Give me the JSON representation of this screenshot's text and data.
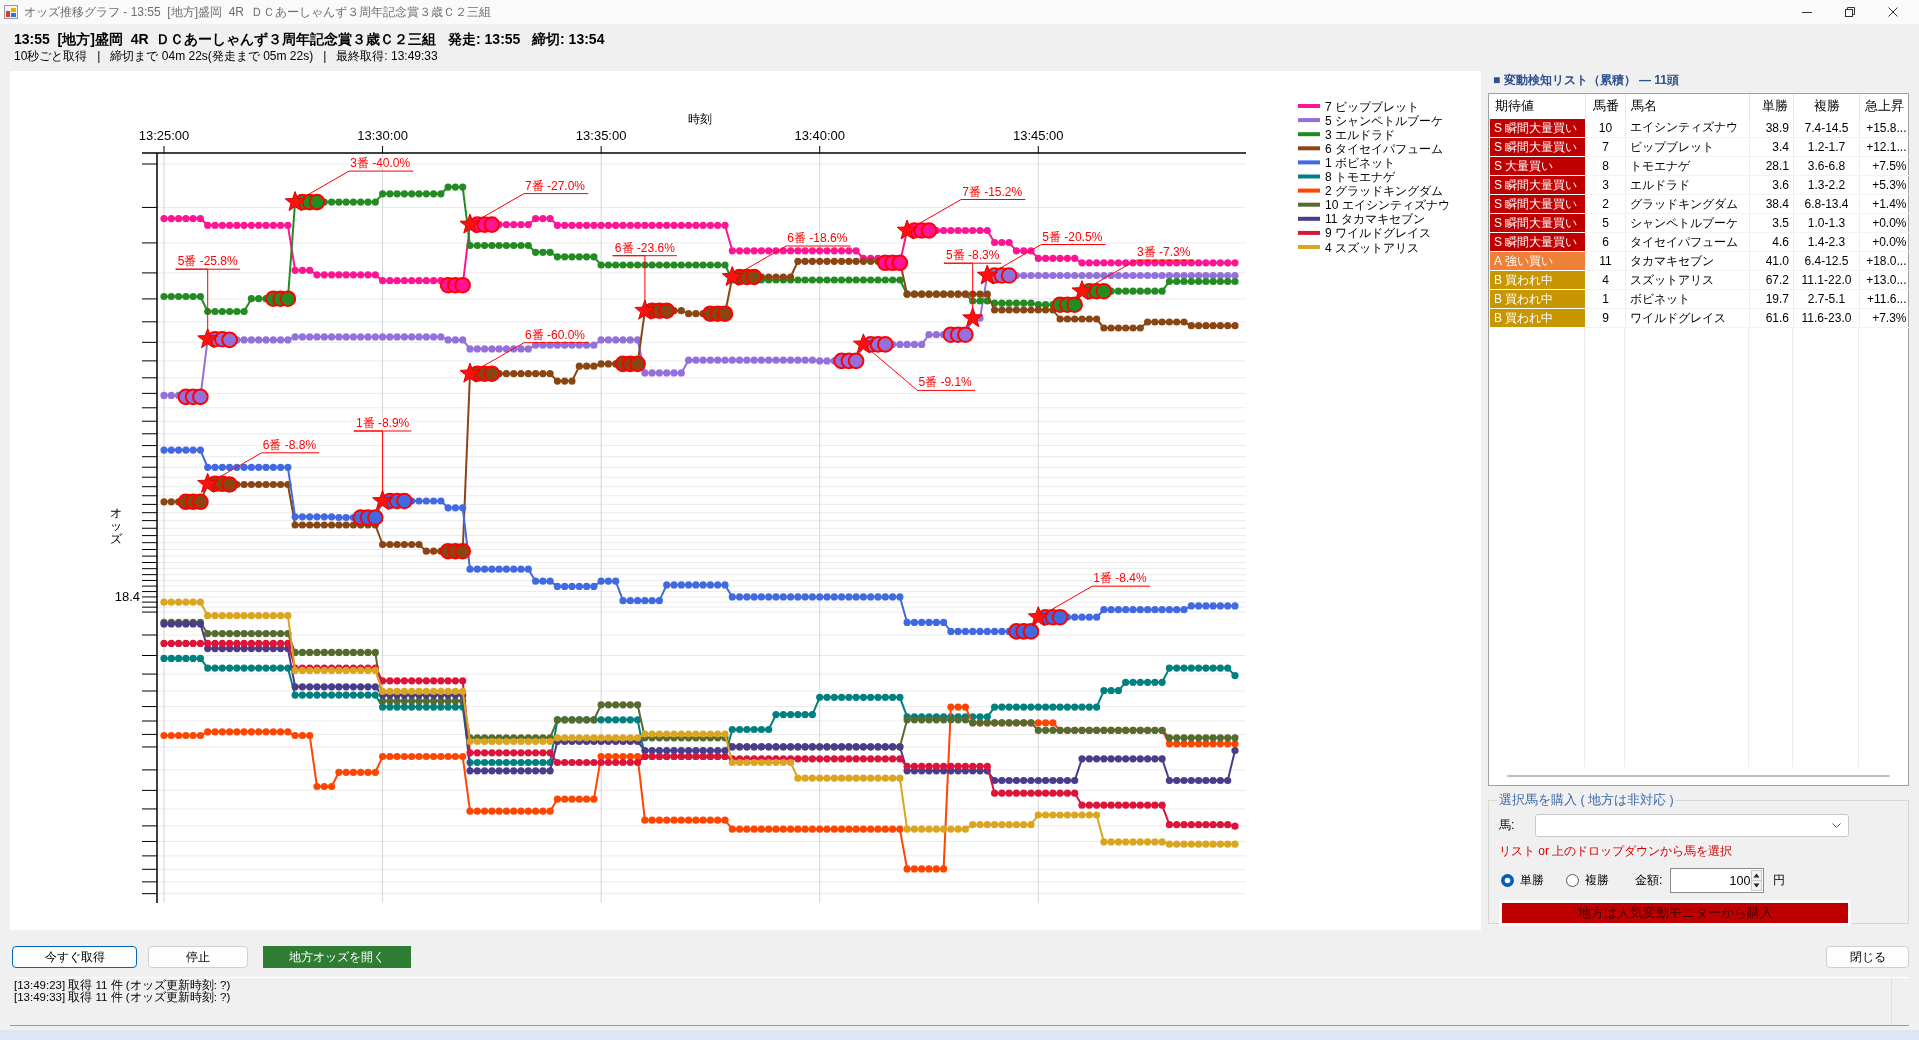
{
  "window": {
    "title": "オッズ推移グラフ - 13:55  [地方]盛岡  4R  ＤＣあーしゃんず３周年記念賞３歳Ｃ２三組"
  },
  "race_header": {
    "title": "13:55  [地方]盛岡  4R  ＤＣあーしゃんず３周年記念賞３歳Ｃ２三組   発走: 13:55   締切: 13:54",
    "status": "10秒ごと取得   |   締切まで 04m 22s(発走まで 05m 22s)   |   最終取得: 13:49:33"
  },
  "chart": {
    "x_axis_title": "時刻",
    "y_axis_title": "オッズ",
    "time_labels": [
      "13:25:00",
      "13:30:00",
      "13:35:00",
      "13:40:00",
      "13:45:00"
    ],
    "odds_label": "18.4",
    "legend": [
      {
        "name": "7 ビップブレット",
        "color": "#ff1493"
      },
      {
        "name": "5 シャンペトルブーケ",
        "color": "#9370db"
      },
      {
        "name": "3 エルドラド",
        "color": "#228b22"
      },
      {
        "name": "6 タイセイパフューム",
        "color": "#8b4513"
      },
      {
        "name": "1 ボビネット",
        "color": "#4169e1"
      },
      {
        "name": "8 トモエナゲ",
        "color": "#008080"
      },
      {
        "name": "2 グラッドキングダム",
        "color": "#ff4500"
      },
      {
        "name": "10 エイシンティズナウ",
        "color": "#556b2f"
      },
      {
        "name": "11 タカマキセブン",
        "color": "#483d8b"
      },
      {
        "name": "9 ワイルドグレイス",
        "color": "#dc143c"
      },
      {
        "name": "4 スズットアリス",
        "color": "#daa520"
      }
    ],
    "notes": [
      "5番 -25.8%",
      "6番 -8.8%",
      "3番 -40.0%",
      "1番 -8.9%",
      "7番 -27.0%",
      "6番 -60.0%",
      "6番 -23.6%",
      "6番 -18.6%",
      "5番 -9.1%",
      "7番 -15.2%",
      "5番 -8.3%",
      "5番 -20.5%",
      "1番 -8.4%",
      "3番 -7.3%"
    ]
  },
  "change_list": {
    "title": "■ 変動検知リスト（累積） — 11頭",
    "columns": [
      "期待値",
      "馬番",
      "馬名",
      "単勝",
      "複勝",
      "急上昇"
    ],
    "rows": [
      {
        "rating": "S 瞬間大量買い",
        "color": "#c00000",
        "number": "10",
        "name": "エイシンティズナウ",
        "win": "38.9",
        "place": "7.4-14.5",
        "surge": "+15.8..."
      },
      {
        "rating": "S 瞬間大量買い",
        "color": "#c00000",
        "number": "7",
        "name": "ビップブレット",
        "win": "3.4",
        "place": "1.2-1.7",
        "surge": "+12.1..."
      },
      {
        "rating": "S 大量買い",
        "color": "#c00000",
        "number": "8",
        "name": "トモエナゲ",
        "win": "28.1",
        "place": "3.6-6.8",
        "surge": "+7.5%"
      },
      {
        "rating": "S 瞬間大量買い",
        "color": "#c00000",
        "number": "3",
        "name": "エルドラド",
        "win": "3.6",
        "place": "1.3-2.2",
        "surge": "+5.3%"
      },
      {
        "rating": "S 瞬間大量買い",
        "color": "#c00000",
        "number": "2",
        "name": "グラッドキングダム",
        "win": "38.4",
        "place": "6.8-13.4",
        "surge": "+1.4%"
      },
      {
        "rating": "S 瞬間大量買い",
        "color": "#c00000",
        "number": "5",
        "name": "シャンペトルブーケ",
        "win": "3.5",
        "place": "1.0-1.3",
        "surge": "+0.0%"
      },
      {
        "rating": "S 瞬間大量買い",
        "color": "#c00000",
        "number": "6",
        "name": "タイセイパフューム",
        "win": "4.6",
        "place": "1.4-2.3",
        "surge": "+0.0%"
      },
      {
        "rating": "A 強い買い",
        "color": "#ef8038",
        "number": "11",
        "name": "タカマキセブン",
        "win": "41.0",
        "place": "6.4-12.5",
        "surge": "+18.0..."
      },
      {
        "rating": "B 買われ中",
        "color": "#c89600",
        "number": "4",
        "name": "スズットアリス",
        "win": "67.2",
        "place": "11.1-22.0",
        "surge": "+13.0..."
      },
      {
        "rating": "B 買われ中",
        "color": "#c89600",
        "number": "1",
        "name": "ボビネット",
        "win": "19.7",
        "place": "2.7-5.1",
        "surge": "+11.6..."
      },
      {
        "rating": "B 買われ中",
        "color": "#c89600",
        "number": "9",
        "name": "ワイルドグレイス",
        "win": "61.6",
        "place": "11.6-23.0",
        "surge": "+7.3%"
      }
    ]
  },
  "purchase": {
    "title": "選択馬を購入 ( 地方は非対応 )",
    "horse_label": "馬:",
    "hint": "リスト or 上のドロップダウンから馬を選択",
    "bet_types": [
      {
        "label": "単勝",
        "selected": true
      },
      {
        "label": "複勝",
        "selected": false
      }
    ],
    "amount_label": "金額:",
    "amount": "100",
    "unit": "円",
    "buy_button": "地方は人気変動モニターから購入"
  },
  "actions": [
    {
      "label": "今すぐ取得",
      "kind": "default"
    },
    {
      "label": "停止",
      "kind": "normal"
    },
    {
      "label": "地方オッズを開く",
      "kind": "accent"
    }
  ],
  "close_button": "閉じる",
  "log": [
    "[13:49:23] 取得 11 件 (オッズ更新時刻: ?)",
    "[13:49:33] 取得 11 件 (オッズ更新時刻: ?)"
  ]
}
